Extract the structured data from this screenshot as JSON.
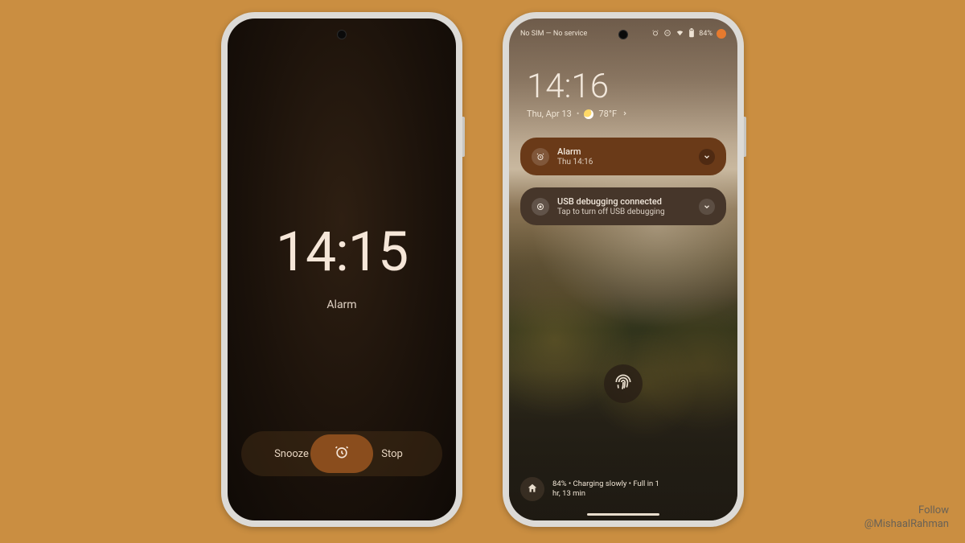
{
  "alarm_screen": {
    "time": "14:15",
    "label": "Alarm",
    "snooze": "Snooze",
    "stop": "Stop"
  },
  "lock_screen": {
    "status": {
      "carrier": "No SIM — No service",
      "battery": "84%"
    },
    "clock": "14:16",
    "date": "Thu, Apr 13",
    "temp": "78°F",
    "notifications": [
      {
        "title": "Alarm",
        "subtitle": "Thu 14:16"
      },
      {
        "title": "USB debugging connected",
        "subtitle": "Tap to turn off USB debugging"
      }
    ],
    "charging_line1": "84% • Charging slowly • Full in 1",
    "charging_line2": "hr, 13 min"
  },
  "credit": {
    "line1": "Follow",
    "line2": "@MishaalRahman"
  }
}
